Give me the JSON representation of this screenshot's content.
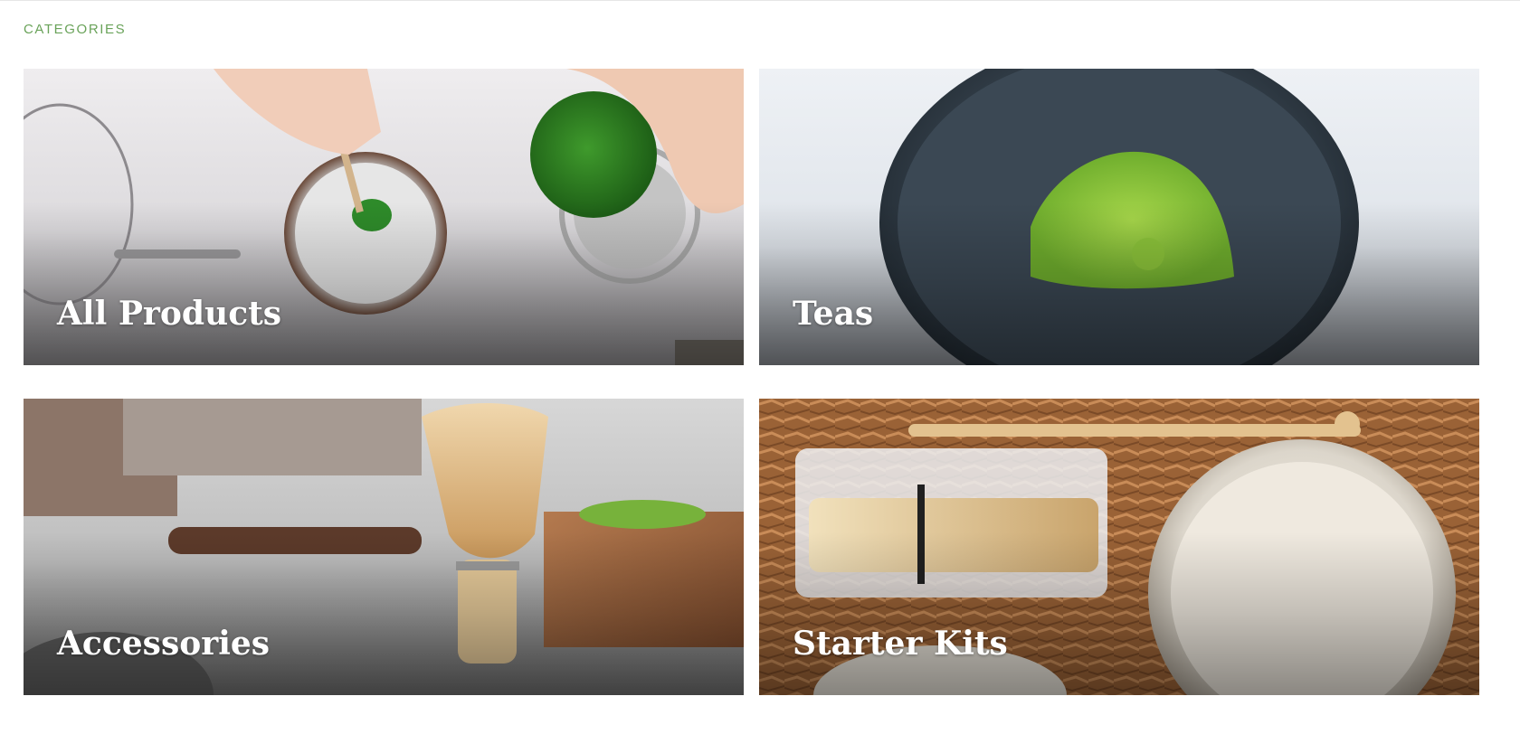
{
  "section": {
    "title": "CATEGORIES"
  },
  "categories": [
    {
      "label": "All Products"
    },
    {
      "label": "Teas"
    },
    {
      "label": "Accessories"
    },
    {
      "label": "Starter Kits"
    }
  ],
  "colors": {
    "section_title": "#6aa35a",
    "label_text": "#ffffff",
    "matcha_green": "#5e9f2f",
    "matcha_light": "#8fc43a",
    "bamboo": "#d9b37a",
    "cardboard": "#a0673a"
  }
}
